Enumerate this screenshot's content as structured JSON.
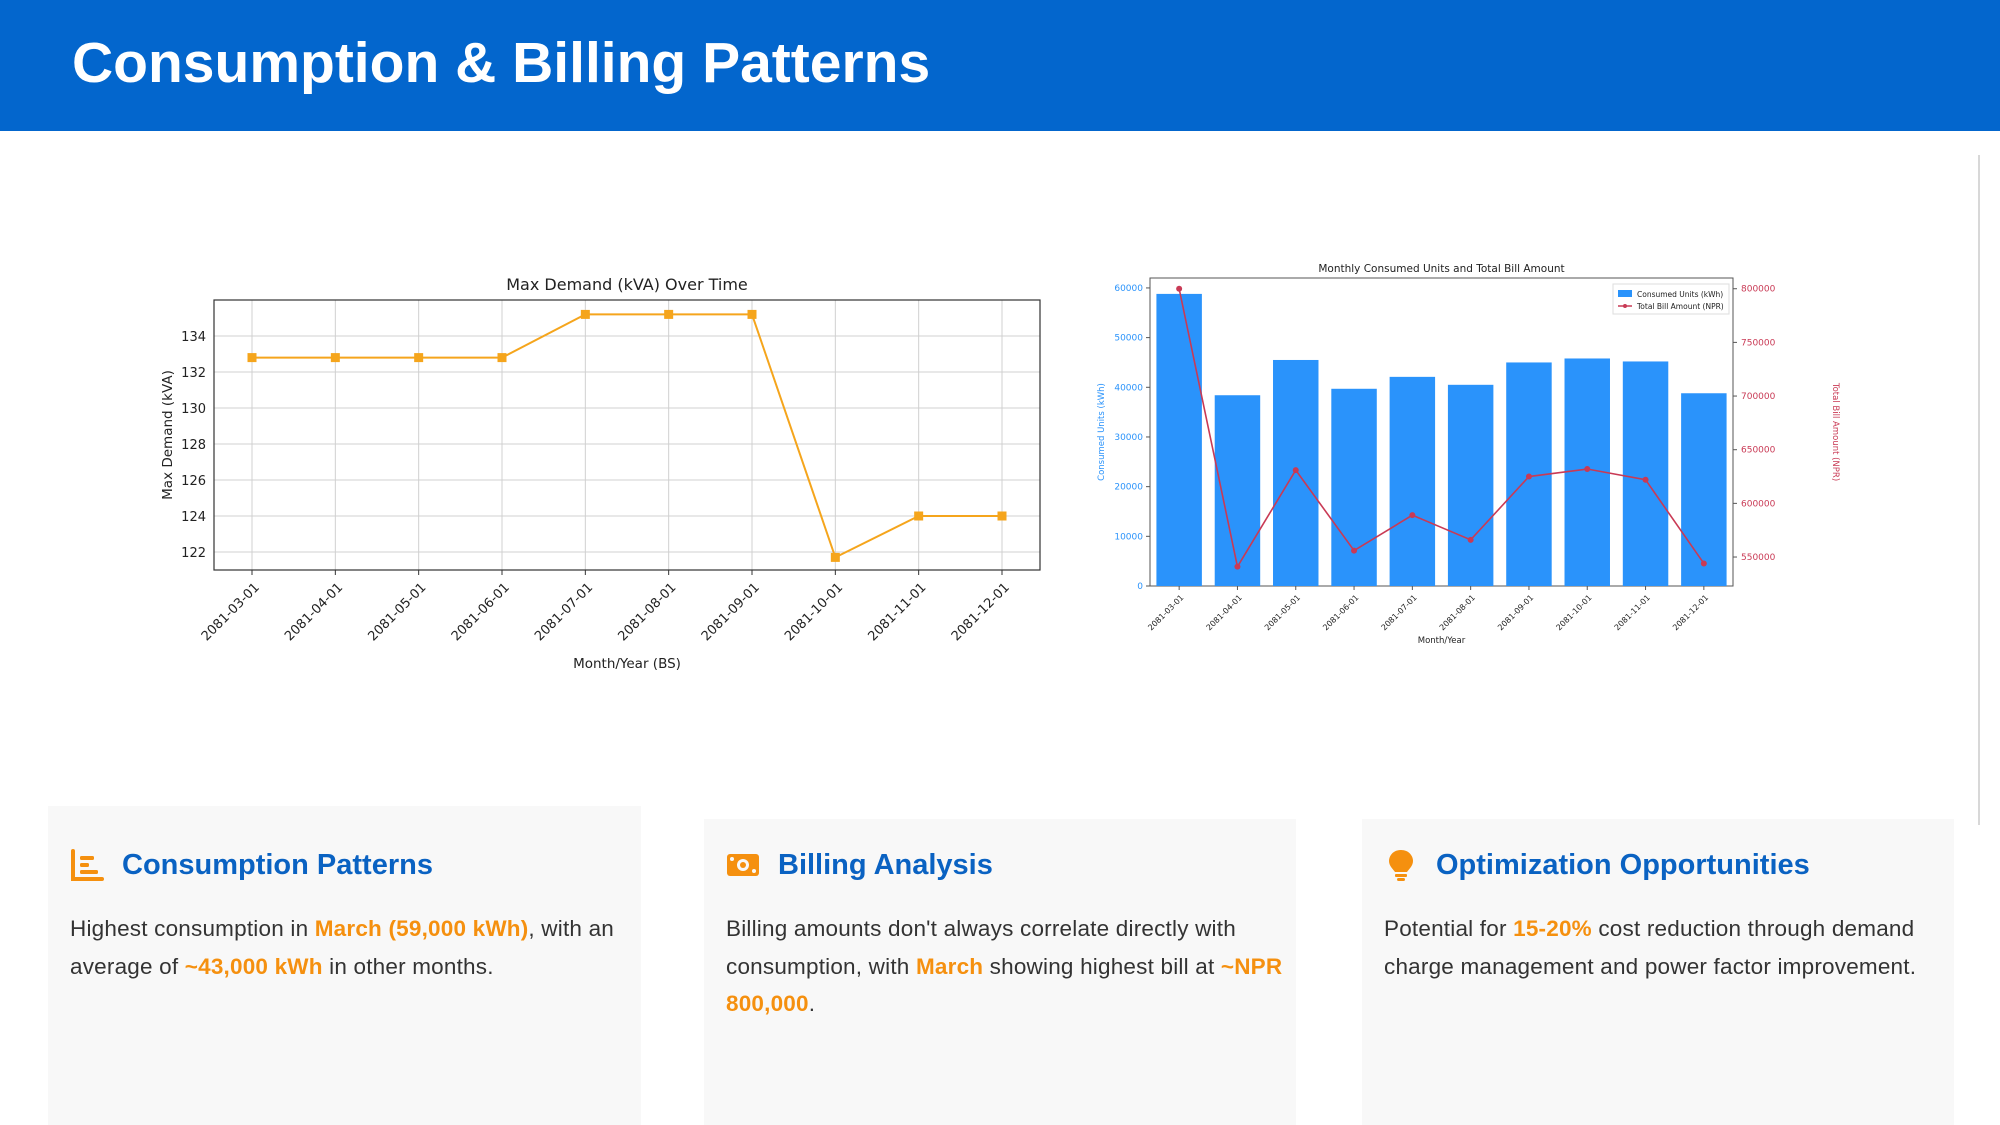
{
  "header": {
    "title": "Consumption & Billing Patterns"
  },
  "colors": {
    "header_bg": "#0366cd",
    "title_blue": "#0a62c2",
    "highlight": "#f5900f",
    "line_orange": "#f5a51c",
    "bar_blue": "#2a93fb",
    "line_red": "#c93a55"
  },
  "chart_data": [
    {
      "type": "line",
      "title": "Max Demand (kVA) Over Time",
      "xlabel": "Month/Year (BS)",
      "ylabel": "Max Demand (kVA)",
      "categories": [
        "2081-03-01",
        "2081-04-01",
        "2081-05-01",
        "2081-06-01",
        "2081-07-01",
        "2081-08-01",
        "2081-09-01",
        "2081-10-01",
        "2081-11-01",
        "2081-12-01"
      ],
      "series": [
        {
          "values": [
            132.8,
            132.8,
            132.8,
            132.8,
            135.2,
            135.2,
            135.2,
            121.7,
            124.0,
            124.0
          ]
        }
      ],
      "ylim": [
        121,
        136
      ],
      "yticks": [
        122,
        124,
        126,
        128,
        130,
        132,
        134
      ],
      "grid": true,
      "marker": "square"
    },
    {
      "type": "bar",
      "title": "Monthly Consumed Units and Total Bill Amount",
      "xlabel": "Month/Year",
      "ylabel": "Consumed Units (kWh)",
      "ylabel_right": "Total Bill Amount (NPR)",
      "categories": [
        "2081-03-01",
        "2081-04-01",
        "2081-05-01",
        "2081-06-01",
        "2081-07-01",
        "2081-08-01",
        "2081-09-01",
        "2081-10-01",
        "2081-11-01",
        "2081-12-01"
      ],
      "series": [
        {
          "name": "Consumed Units (kWh)",
          "axis": "left",
          "values": [
            58800,
            38400,
            45500,
            39700,
            42100,
            40500,
            45000,
            45800,
            45200,
            38800
          ]
        },
        {
          "name": "Total Bill Amount (NPR)",
          "axis": "right",
          "values": [
            800000,
            541000,
            631000,
            556000,
            589000,
            566000,
            625000,
            632000,
            622000,
            544000
          ]
        }
      ],
      "ylim": [
        0,
        62000
      ],
      "yticks": [
        0,
        10000,
        20000,
        30000,
        40000,
        50000,
        60000
      ],
      "ylim_right": [
        523000,
        810000
      ],
      "yticks_right": [
        550000,
        600000,
        650000,
        700000,
        750000,
        800000
      ],
      "legend": "top-right"
    }
  ],
  "cards": [
    {
      "icon": "chart-bar-icon",
      "title": "Consumption Patterns",
      "segments": [
        {
          "text": "Highest consumption in ",
          "hl": false
        },
        {
          "text": "March (59,000 kWh)",
          "hl": true
        },
        {
          "text": ", with an average of ",
          "hl": false
        },
        {
          "text": "~43,000 kWh",
          "hl": true
        },
        {
          "text": " in other months.",
          "hl": false
        }
      ]
    },
    {
      "icon": "money-bill-icon",
      "title": "Billing Analysis",
      "segments": [
        {
          "text": "Billing amounts don't always correlate directly with consumption, with ",
          "hl": false
        },
        {
          "text": "March",
          "hl": true
        },
        {
          "text": " showing highest bill at ",
          "hl": false
        },
        {
          "text": "~NPR 800,000",
          "hl": true
        },
        {
          "text": ".",
          "hl": false
        }
      ]
    },
    {
      "icon": "lightbulb-icon",
      "title": "Optimization Opportunities",
      "segments": [
        {
          "text": "Potential for ",
          "hl": false
        },
        {
          "text": "15-20%",
          "hl": true
        },
        {
          "text": " cost reduction through demand charge management and power factor improvement.",
          "hl": false
        }
      ]
    }
  ]
}
